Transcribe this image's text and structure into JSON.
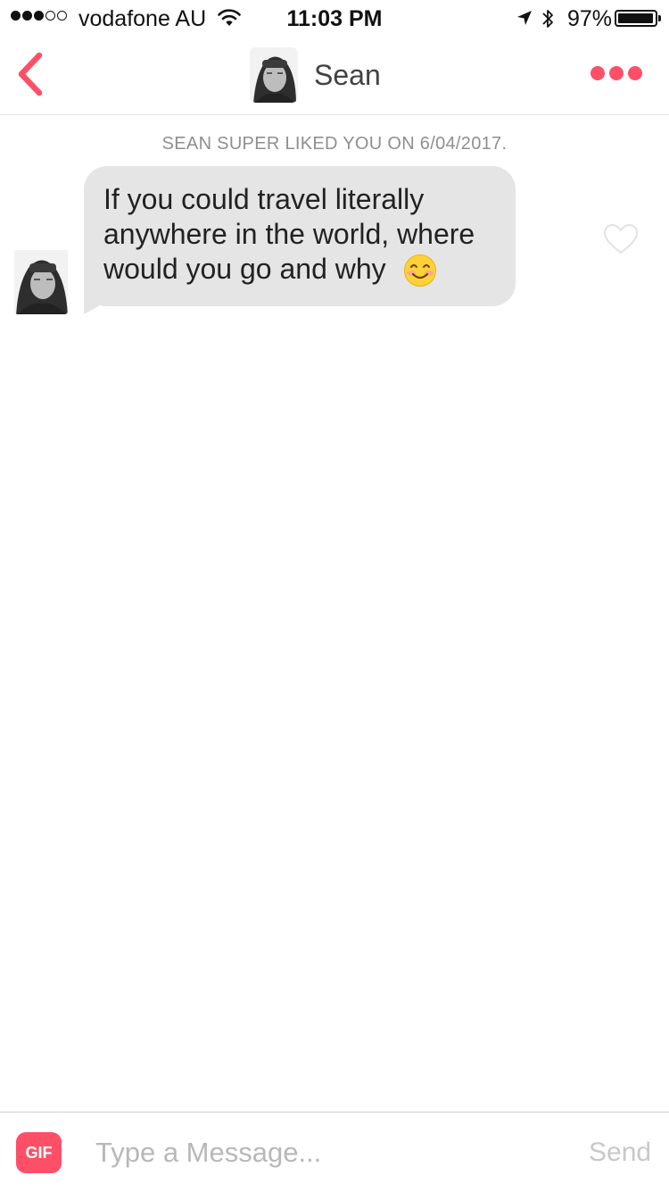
{
  "status_bar": {
    "carrier": "vodafone AU",
    "signal_bars_filled": 3,
    "signal_bars_total": 5,
    "time": "11:03 PM",
    "battery_percent_label": "97%",
    "battery_level": 0.97,
    "icons": [
      "wifi-icon",
      "location-arrow-icon",
      "bluetooth-icon",
      "battery-icon"
    ]
  },
  "header": {
    "name": "Sean",
    "icons": [
      "back-chevron-icon",
      "more-dots-icon"
    ]
  },
  "conversation": {
    "notice": "SEAN SUPER LIKED YOU ON 6/04/2017.",
    "messages": [
      {
        "sender": "Sean",
        "lines": [
          "If you could travel literally",
          "anywhere in the world, where",
          "would you go and why"
        ],
        "emoji": "smiling-face-icon",
        "liked": false
      }
    ]
  },
  "composer": {
    "gif_label": "GIF",
    "placeholder": "Type a Message...",
    "value": "",
    "send_label": "Send"
  },
  "colors": {
    "accent": "#fd5068",
    "bubble": "#e5e5e5",
    "notice_text": "#8f8f8f",
    "placeholder": "#b8b8b8"
  }
}
